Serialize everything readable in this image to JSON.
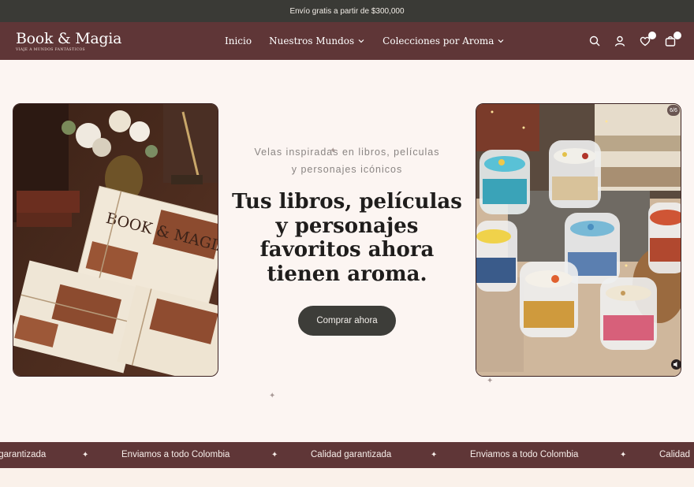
{
  "announcement": "Envío gratis a partir de $300,000",
  "logo": {
    "name": "Book & Magia",
    "tagline": "VIAJE A MUNDOS FANTÁSTICOS"
  },
  "nav": [
    {
      "label": "Inicio"
    },
    {
      "label": "Nuestros Mundos"
    },
    {
      "label": "Colecciones por Aroma"
    }
  ],
  "icons": [
    "search-icon",
    "account-icon",
    "wishlist-icon",
    "cart-icon"
  ],
  "hero": {
    "subtitle_line1": "Velas inspiradas en libros, películas",
    "subtitle_line2": "y personajes icónicos",
    "headline_line1": "Tus libros, películas",
    "headline_line2": "y personajes",
    "headline_line3": "favoritos ahora",
    "headline_line4": "tienen aroma.",
    "cta": "Comprar ahora",
    "left_image_alt": "Velas envueltas en papel Book & Magia",
    "right_image_alt": "Velas en frascos sobre libros",
    "slide_counter": "6/6"
  },
  "marquee": [
    "Calidad garantizada",
    "Enviamos a todo Colombia",
    "Calidad garantizada",
    "Enviamos a todo Colombia",
    "Calidad"
  ],
  "colors": {
    "brand": "#5f3637",
    "announcement_bg": "#3a3a36",
    "cta_bg": "#3d3d39",
    "page_bg": "#fcf5f2"
  }
}
